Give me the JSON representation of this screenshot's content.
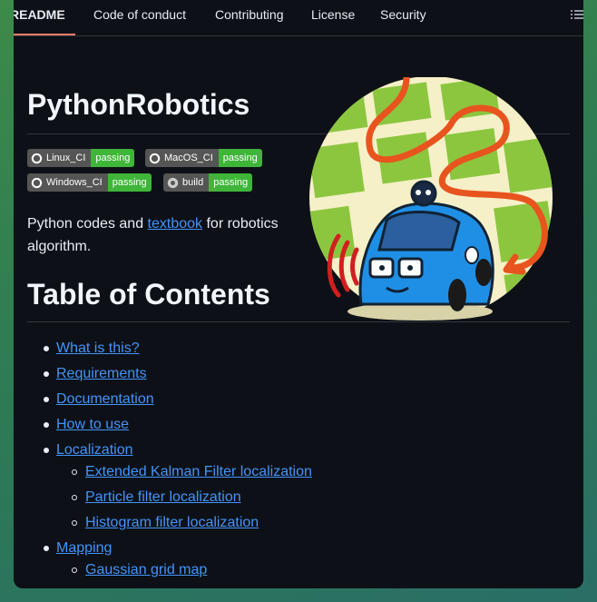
{
  "tabs": [
    {
      "label": "README"
    },
    {
      "label": "Code of conduct"
    },
    {
      "label": "Contributing"
    },
    {
      "label": "License"
    },
    {
      "label": "Security"
    }
  ],
  "title": "PythonRobotics",
  "badges": [
    {
      "label": "Linux_CI",
      "status": "passing",
      "icon": "github-icon"
    },
    {
      "label": "MacOS_CI",
      "status": "passing",
      "icon": "github-icon"
    },
    {
      "label": "Windows_CI",
      "status": "passing",
      "icon": "github-icon"
    },
    {
      "label": "build",
      "status": "passing",
      "icon": "appveyor-icon"
    }
  ],
  "intro": {
    "before": "Python codes and ",
    "link": "textbook",
    "after": " for robotics algorithm."
  },
  "toc_title": "Table of Contents",
  "toc": [
    {
      "label": "What is this?"
    },
    {
      "label": "Requirements"
    },
    {
      "label": "Documentation"
    },
    {
      "label": "How to use"
    },
    {
      "label": "Localization",
      "children": [
        {
          "label": "Extended Kalman Filter localization"
        },
        {
          "label": "Particle filter localization"
        },
        {
          "label": "Histogram filter localization"
        }
      ]
    },
    {
      "label": "Mapping",
      "children": [
        {
          "label": "Gaussian grid map"
        }
      ]
    }
  ],
  "colors": {
    "background": "#0d1117",
    "link": "#4493f8",
    "badge_pass": "#3fb53a",
    "tab_accent": "#f78166"
  }
}
